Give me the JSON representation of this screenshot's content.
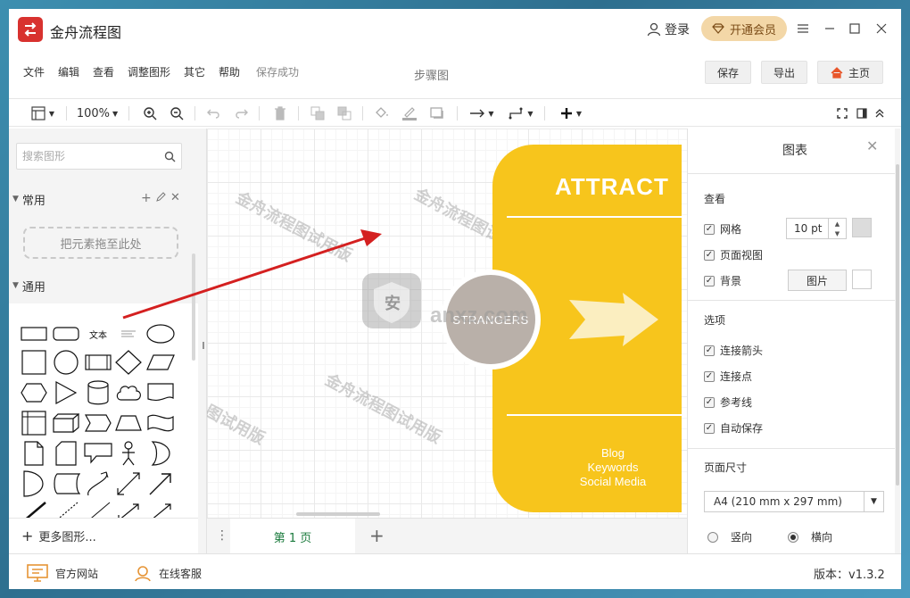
{
  "app": {
    "title": "金舟流程图",
    "login_label": "登录",
    "vip_label": "开通会员",
    "doc_title": "步骤图"
  },
  "menu": {
    "items": [
      "文件",
      "编辑",
      "查看",
      "调整图形",
      "其它",
      "帮助"
    ],
    "status": "保存成功"
  },
  "top_buttons": {
    "save": "保存",
    "export": "导出",
    "home": "主页"
  },
  "toolbar": {
    "zoom": "100%"
  },
  "left_panel": {
    "search_placeholder": "搜索图形",
    "section_common": "常用",
    "drop_hint": "把元素拖至此处",
    "section_general": "通用",
    "text_shape_label": "文本",
    "more_shapes": "更多图形..."
  },
  "canvas": {
    "card_title": "ATTRACT",
    "circle_text": "STRANGERS",
    "card_list": [
      "Blog",
      "Keywords",
      "Social Media"
    ],
    "watermark": "金舟流程图试用版",
    "watermark_partial": "图试用版",
    "center_watermark_text": "anxz.com",
    "center_watermark_badge": "安"
  },
  "page_tabs": {
    "current": "第 1 页"
  },
  "right_panel": {
    "title": "图表",
    "view_section": "查看",
    "grid_label": "网格",
    "grid_size": "10 pt",
    "page_view_label": "页面视图",
    "background_label": "背景",
    "image_button": "图片",
    "options_section": "选项",
    "connect_arrows": "连接箭头",
    "connect_points": "连接点",
    "guides": "参考线",
    "autosave": "自动保存",
    "page_size_section": "页面尺寸",
    "page_size_value": "A4 (210 mm x 297 mm)",
    "portrait": "竖向",
    "landscape": "横向"
  },
  "statusbar": {
    "website": "官方网站",
    "support": "在线客服",
    "version": "版本：v1.3.2"
  },
  "colors": {
    "accent_red": "#d8322f",
    "vip_bg": "#f3d7a7",
    "card_yellow": "#f7c51c",
    "page_tab_green": "#1a7a3c",
    "arrow_red": "#d42020"
  }
}
